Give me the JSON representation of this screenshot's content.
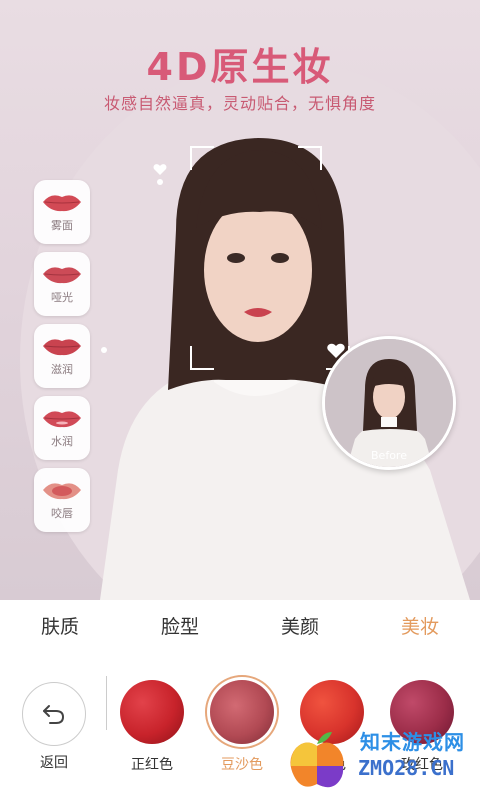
{
  "hero": {
    "title": "4D原生妆",
    "subtitle": "妆感自然逼真，灵动贴合，无惧角度"
  },
  "lip_styles": [
    {
      "label": "雾面",
      "color": "#d24a55"
    },
    {
      "label": "哑光",
      "color": "#cc4b57"
    },
    {
      "label": "滋润",
      "color": "#c9434f"
    },
    {
      "label": "水润",
      "color": "#d14a57"
    },
    {
      "label": "咬唇",
      "color": "#d35a5c"
    }
  ],
  "before_label": "Before",
  "tabs": [
    {
      "label": "肤质",
      "active": false
    },
    {
      "label": "脸型",
      "active": false
    },
    {
      "label": "美颜",
      "active": false
    },
    {
      "label": "美妆",
      "active": true
    }
  ],
  "toolbar": {
    "back_label": "返回",
    "swatches": [
      {
        "name": "正红色",
        "color": "#c8232b",
        "selected": false
      },
      {
        "name": "豆沙色",
        "color": "#b24a54",
        "selected": true
      },
      {
        "name": "橘色",
        "color": "#d8332c",
        "selected": false
      },
      {
        "name": "玫红色",
        "color": "#9c2d49",
        "selected": false
      }
    ]
  },
  "watermark": {
    "brand": "知末游戏网",
    "url": "ZMO28.CN"
  },
  "colors": {
    "accent": "#e39a5d",
    "title": "#d85a78"
  }
}
